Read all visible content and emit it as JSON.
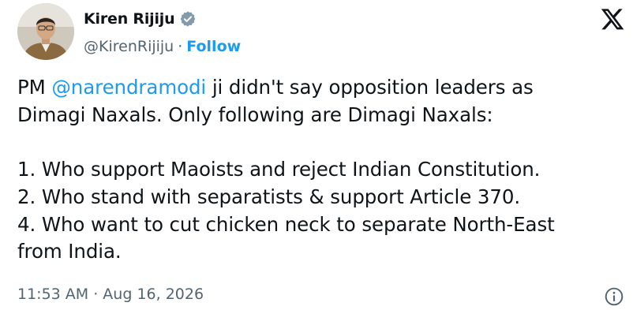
{
  "author": {
    "name": "Kiren Rijiju",
    "handle": "@KirenRijiju",
    "separator": "·",
    "follow_label": "Follow",
    "verified_icon": "verified-badge-icon"
  },
  "brand_icon": "x-logo-icon",
  "tweet": {
    "line1_prefix": "PM ",
    "mention": "@narendramodi",
    "line1_suffix": " ji didn't say opposition leaders as",
    "line2": "Dimagi Naxals. Only following are Dimagi Naxals:",
    "line3": "",
    "line4": "1. Who support Maoists and reject Indian Constitution.",
    "line5": "2. Who stand with separatists & support Article 370.",
    "line6": "4. Who want to cut chicken neck to separate North-East",
    "line7": "from India."
  },
  "timestamp": "11:53 AM · Aug 16, 2026",
  "info_icon": "info-icon",
  "colors": {
    "accent": "#1d9bf0",
    "text": "#0f1419",
    "muted": "#536471"
  }
}
